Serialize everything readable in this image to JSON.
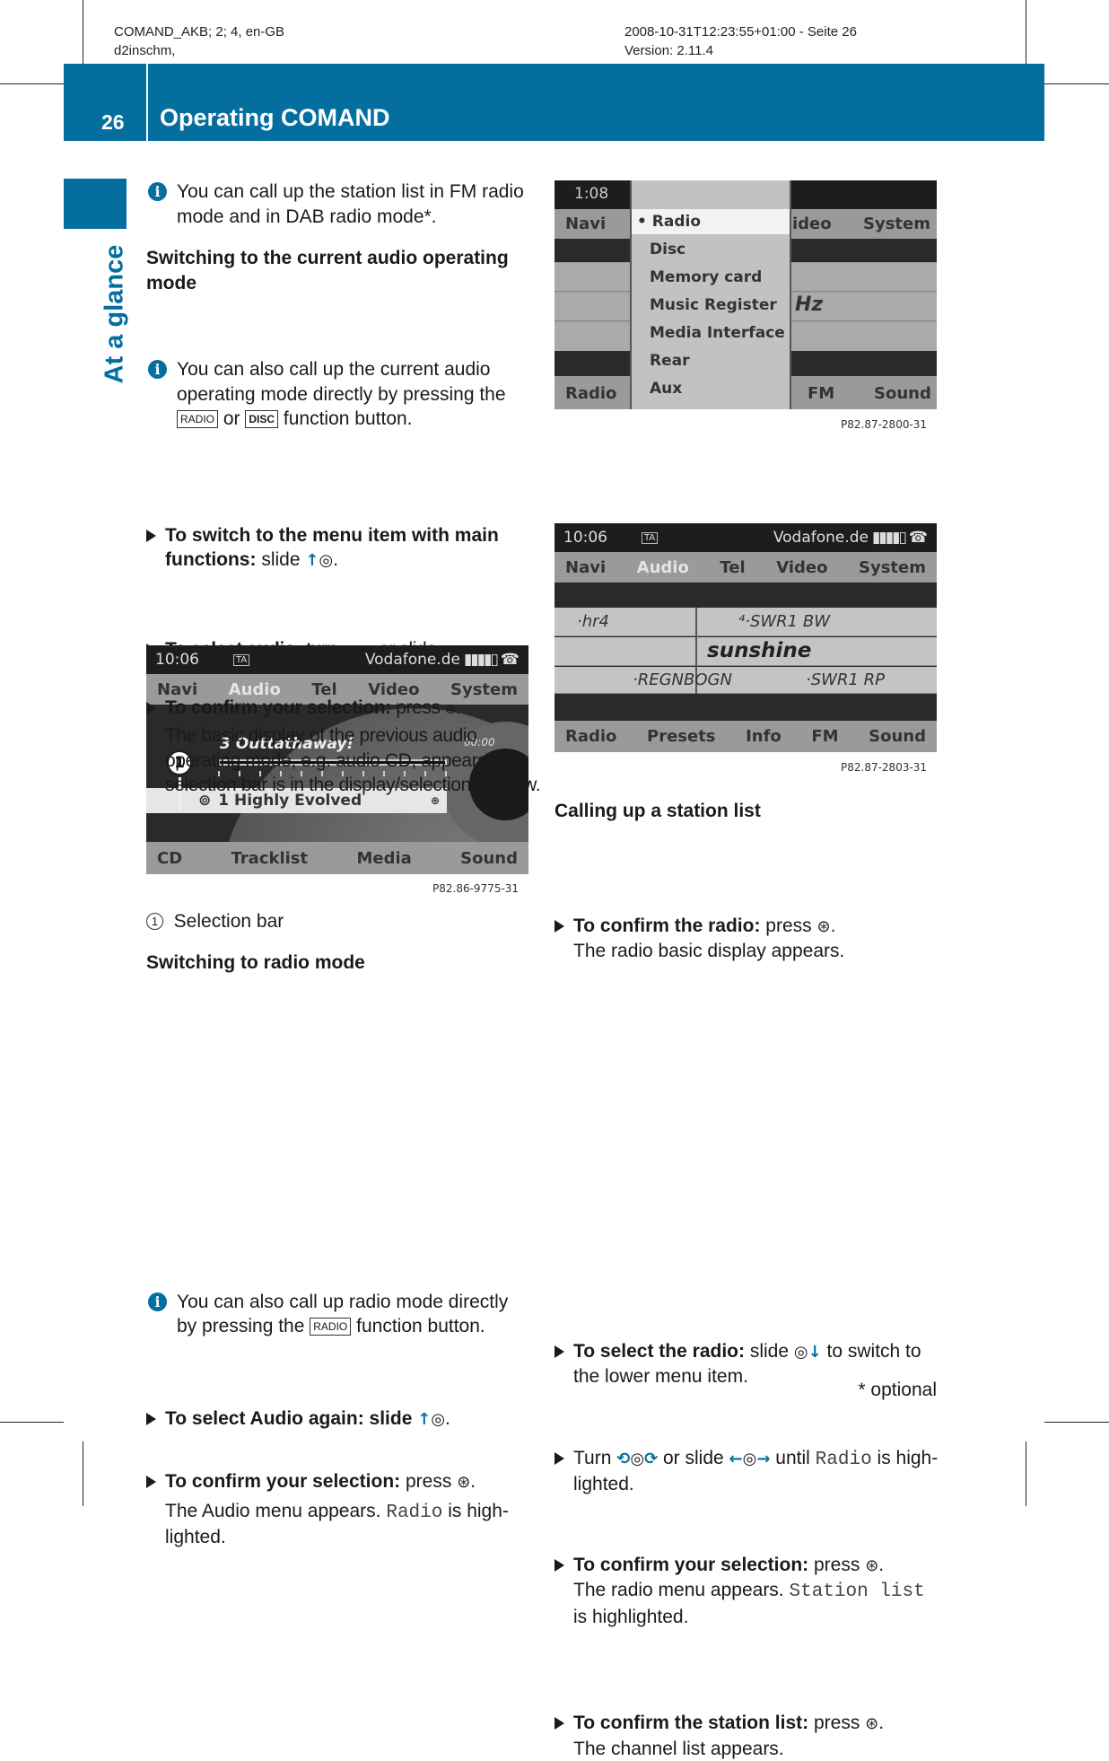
{
  "meta": {
    "left1": "COMAND_AKB; 2; 4, en-GB",
    "left2": "d2inschm,",
    "right1": "2008-10-31T12:23:55+01:00 - Seite 26",
    "right2": "Version: 2.11.4"
  },
  "header": {
    "page": "26",
    "title": "Operating COMAND",
    "side_label": "At a glance",
    "accent": "#046e9f"
  },
  "left": {
    "info1": "You can call up the station list in FM radio mode and in DAB radio mode*.",
    "heading1": "Switching to the current audio operating mode",
    "info2_a": "You can also call up the current audio operating mode directly by pressing the",
    "key_radio": "RADIO",
    "or": "or",
    "key_disc": "DISC",
    "info2_b": "function button.",
    "step1_bold": "To switch to the menu item with main functions:",
    "step1_text": "slide",
    "step2_bold": "To select audio:",
    "step2_text": "turn",
    "step2_or": "or slide",
    "step3_bold": "To confirm your selection:",
    "step3_text": "press",
    "step3_result": "The basic display of the previous audio operating mode, e.g. audio CD, appears. The selection bar is in the display/selection window.",
    "caption_num": "1",
    "caption": "Selection bar",
    "heading2": "Switching to radio mode",
    "info3_a": "You can also call up radio mode directly by pressing the",
    "info3_b": "function button.",
    "step4_bold": "To select Audio again: slide",
    "step5_bold": "To confirm your selection:",
    "step5_text": "press",
    "step5_result_a": "The Audio menu appears.",
    "step5_mono": "Radio",
    "step5_result_b": "is high-lighted."
  },
  "screen1": {
    "time": "10:06",
    "ta": "TA",
    "network": "Vodafone.de",
    "menu": [
      "Navi",
      "Audio",
      "Tel",
      "Video",
      "System"
    ],
    "track": "3 Outtathaway!",
    "elapsed": "00:00",
    "selection": "1 Highly Evolved",
    "callout": "1",
    "bottom": [
      "CD",
      "Tracklist",
      "Media",
      "Sound"
    ],
    "ref": "P82.86-9775-31"
  },
  "screen2": {
    "time": "1:08",
    "left_menu": "Navi",
    "right_menu": [
      "ideo",
      "System"
    ],
    "options": [
      "Radio",
      "Disc",
      "Memory card",
      "Music Register",
      "Media Interface",
      "Rear",
      "Aux"
    ],
    "selected": "Radio",
    "hz": "Hz",
    "bottom_left": "Radio",
    "bottom_right": [
      "FM",
      "Sound"
    ],
    "ref": "P82.87-2800-31"
  },
  "screen3": {
    "time": "10:06",
    "ta": "TA",
    "network": "Vodafone.de",
    "menu": [
      "Navi",
      "Audio",
      "Tel",
      "Video",
      "System"
    ],
    "st_hr4": "·hr4",
    "st_swr1bw": "⁴·SWR1 BW",
    "st_current": "sunshine",
    "st_regnb": "·REGNBOGN",
    "st_swr1rp": "·SWR1 RP",
    "bottom": [
      "Radio",
      "Presets",
      "Info",
      "FM",
      "Sound"
    ],
    "ref": "P82.87-2803-31"
  },
  "right": {
    "step1_bold": "To confirm the radio:",
    "step1_text": "press",
    "step1_result": "The radio basic display appears.",
    "heading": "Calling up a station list",
    "step2_bold": "To select the radio:",
    "step2_text": "slide",
    "step2_text_b": "to switch to the lower menu item.",
    "step3_text": "Turn",
    "step3_or": "or slide",
    "step3_until": "until",
    "step3_mono": "Radio",
    "step3_b": "is high-lighted.",
    "step4_bold": "To confirm your selection:",
    "step4_text": "press",
    "step4_result_a": "The radio menu appears.",
    "step4_mono": "Station list",
    "step4_result_b": "is highlighted.",
    "step5_bold": "To confirm the station list:",
    "step5_text": "press",
    "step5_result": "The channel list appears.",
    "footnote": "* optional"
  }
}
